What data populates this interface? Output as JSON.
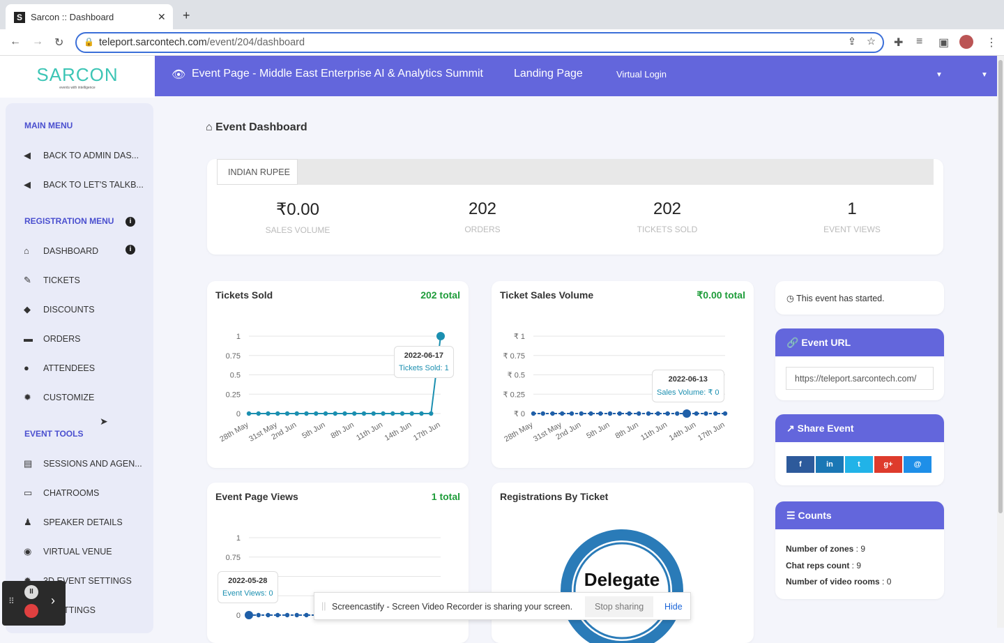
{
  "browser": {
    "tab_title": "Sarcon :: Dashboard",
    "url_host": "teleport.sarcontech.com",
    "url_path": "/event/204/dashboard"
  },
  "logo": {
    "text": "SARCON",
    "tagline": "events with intelligence"
  },
  "topnav": {
    "event_page": "Event Page - Middle East Enterprise AI & Analytics Summit",
    "landing": "Landing Page",
    "virtual_login": "Virtual Login"
  },
  "sidebar": {
    "main_menu": "MAIN MENU",
    "main_items": [
      {
        "label": "BACK TO ADMIN DAS...",
        "icon": "arrow-left-icon"
      },
      {
        "label": "BACK TO LET'S TALKB...",
        "icon": "arrow-left-icon"
      }
    ],
    "registration_menu": "REGISTRATION MENU",
    "registration_items": [
      {
        "label": "DASHBOARD",
        "icon": "home-icon"
      },
      {
        "label": "TICKETS",
        "icon": "ticket-icon"
      },
      {
        "label": "DISCOUNTS",
        "icon": "tag-icon"
      },
      {
        "label": "ORDERS",
        "icon": "cart-icon"
      },
      {
        "label": "ATTENDEES",
        "icon": "user-icon"
      },
      {
        "label": "CUSTOMIZE",
        "icon": "gear-icon"
      }
    ],
    "event_tools": "EVENT TOOLS",
    "tool_items": [
      {
        "label": "SESSIONS AND AGEN...",
        "icon": "list-icon"
      },
      {
        "label": "CHATROOMS",
        "icon": "chat-icon"
      },
      {
        "label": "SPEAKER DETAILS",
        "icon": "speaker-icon"
      },
      {
        "label": "VIRTUAL VENUE",
        "icon": "globe-icon"
      },
      {
        "label": "3D EVENT SETTINGS",
        "icon": "gear-icon"
      },
      {
        "label": "N SETTINGS",
        "icon": "gear-icon"
      }
    ]
  },
  "main": {
    "title": "Event Dashboard",
    "currency_tab": "INDIAN RUPEE",
    "stats": [
      {
        "value": "₹0.00",
        "label": "SALES VOLUME"
      },
      {
        "value": "202",
        "label": "ORDERS"
      },
      {
        "value": "202",
        "label": "TICKETS SOLD"
      },
      {
        "value": "1",
        "label": "EVENT VIEWS"
      }
    ]
  },
  "chart_data": [
    {
      "type": "line",
      "title": "Tickets Sold",
      "total": "202 total",
      "x": [
        "28th May",
        "29th May",
        "30th May",
        "31st May",
        "1st Jun",
        "2nd Jun",
        "3rd Jun",
        "4th Jun",
        "5th Jun",
        "6th Jun",
        "7th Jun",
        "8th Jun",
        "9th Jun",
        "10th Jun",
        "11th Jun",
        "12th Jun",
        "13th Jun",
        "14th Jun",
        "15th Jun",
        "16th Jun",
        "17th Jun"
      ],
      "tick_labels": [
        "28th May",
        "31st May",
        "2nd Jun",
        "5th Jun",
        "8th Jun",
        "11th Jun",
        "14th Jun",
        "17th Jun"
      ],
      "yticks": [
        "0",
        "0.25",
        "0.5",
        "0.75",
        "1"
      ],
      "values": [
        0,
        0,
        0,
        0,
        0,
        0,
        0,
        0,
        0,
        0,
        0,
        0,
        0,
        0,
        0,
        0,
        0,
        0,
        0,
        0,
        1
      ],
      "ylim": [
        0,
        1
      ],
      "tooltip": {
        "date": "2022-06-17",
        "text": "Tickets Sold: 1",
        "index": 20
      },
      "color": "#1b8fb0"
    },
    {
      "type": "line",
      "title": "Ticket Sales Volume",
      "total": "₹0.00 total",
      "x": [
        "28th May",
        "29th May",
        "30th May",
        "31st May",
        "1st Jun",
        "2nd Jun",
        "3rd Jun",
        "4th Jun",
        "5th Jun",
        "6th Jun",
        "7th Jun",
        "8th Jun",
        "9th Jun",
        "10th Jun",
        "11th Jun",
        "12th Jun",
        "13th Jun",
        "14th Jun",
        "15th Jun",
        "16th Jun",
        "17th Jun"
      ],
      "tick_labels": [
        "28th May",
        "31st May",
        "2nd Jun",
        "5th Jun",
        "8th Jun",
        "11th Jun",
        "14th Jun",
        "17th Jun"
      ],
      "yticks": [
        "₹ 0",
        "₹ 0.25",
        "₹ 0.5",
        "₹ 0.75",
        "₹ 1"
      ],
      "values": [
        0,
        0,
        0,
        0,
        0,
        0,
        0,
        0,
        0,
        0,
        0,
        0,
        0,
        0,
        0,
        0,
        0,
        0,
        0,
        0,
        0
      ],
      "ylim": [
        0,
        1
      ],
      "tooltip": {
        "date": "2022-06-13",
        "text": "Sales Volume: ₹ 0",
        "index": 16
      },
      "color": "#1f5fa8"
    },
    {
      "type": "line",
      "title": "Event Page Views",
      "total": "1 total",
      "yticks": [
        "0",
        "0.25",
        "0.5",
        "0.75",
        "1"
      ],
      "values": [
        0,
        0,
        0,
        0,
        0,
        0,
        0,
        0,
        0,
        0,
        0,
        0,
        0,
        0,
        0,
        0,
        0,
        0,
        0,
        0,
        0
      ],
      "ylim": [
        0,
        1
      ],
      "tooltip": {
        "date": "2022-05-28",
        "text": "Event Views: 0",
        "index": 0
      },
      "color": "#1f5fa8"
    },
    {
      "type": "pie",
      "title": "Registrations By Ticket",
      "labels": [
        "Delegate"
      ]
    }
  ],
  "right": {
    "started": "This event has started.",
    "event_url_title": "Event URL",
    "event_url": "https://teleport.sarcontech.com/",
    "share_title": "Share Event",
    "share": [
      {
        "icon": "facebook-icon",
        "glyph": "f",
        "color": "#2d5a9b"
      },
      {
        "icon": "linkedin-icon",
        "glyph": "in",
        "color": "#1a77b5"
      },
      {
        "icon": "twitter-icon",
        "glyph": "t",
        "color": "#21b3e8"
      },
      {
        "icon": "google-plus-icon",
        "glyph": "g+",
        "color": "#de3b2c"
      },
      {
        "icon": "email-icon",
        "glyph": "@",
        "color": "#1e8fe8"
      }
    ],
    "counts_title": "Counts",
    "counts": [
      {
        "label": "Number of zones",
        "value": "9"
      },
      {
        "label": "Chat reps count",
        "value": "9"
      },
      {
        "label": "Number of video rooms",
        "value": "0"
      }
    ]
  },
  "screencastify": {
    "message": "Screencastify - Screen Video Recorder is sharing your screen.",
    "stop": "Stop sharing",
    "hide": "Hide"
  }
}
